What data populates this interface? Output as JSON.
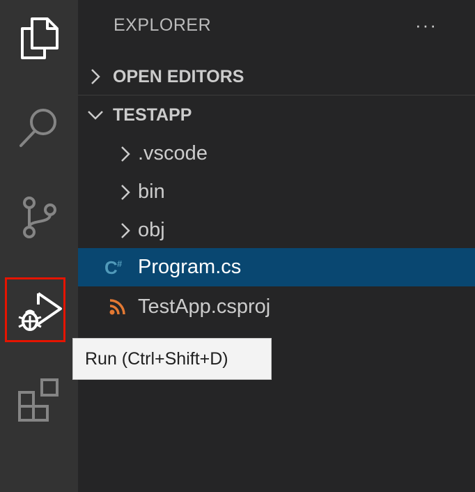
{
  "activity_bar": {
    "items": [
      {
        "id": "explorer",
        "icon": "files-icon"
      },
      {
        "id": "search",
        "icon": "search-icon"
      },
      {
        "id": "source-control",
        "icon": "source-control-icon"
      },
      {
        "id": "run",
        "icon": "run-debug-icon",
        "highlighted": true
      },
      {
        "id": "extensions",
        "icon": "extensions-icon"
      }
    ],
    "highlight_color": "#e51400"
  },
  "sidebar": {
    "title": "EXPLORER",
    "more_actions": "···",
    "sections": [
      {
        "label": "OPEN EDITORS",
        "expanded": false
      },
      {
        "label": "TESTAPP",
        "expanded": true
      }
    ],
    "tree": [
      {
        "name": ".vscode",
        "type": "folder",
        "icon": "chevron-right-icon"
      },
      {
        "name": "bin",
        "type": "folder",
        "icon": "chevron-right-icon"
      },
      {
        "name": "obj",
        "type": "folder",
        "icon": "chevron-right-icon"
      },
      {
        "name": "Program.cs",
        "type": "file",
        "icon": "csharp-file-icon",
        "selected": true
      },
      {
        "name": "TestApp.csproj",
        "type": "file",
        "icon": "rss-file-icon"
      }
    ]
  },
  "tooltip": {
    "text": "Run (Ctrl+Shift+D)"
  },
  "colors": {
    "activity_bar_bg": "#333333",
    "sidebar_bg": "#252526",
    "selection_bg": "#094771",
    "csharp_icon": "#519aba",
    "rss_icon": "#e37933"
  }
}
